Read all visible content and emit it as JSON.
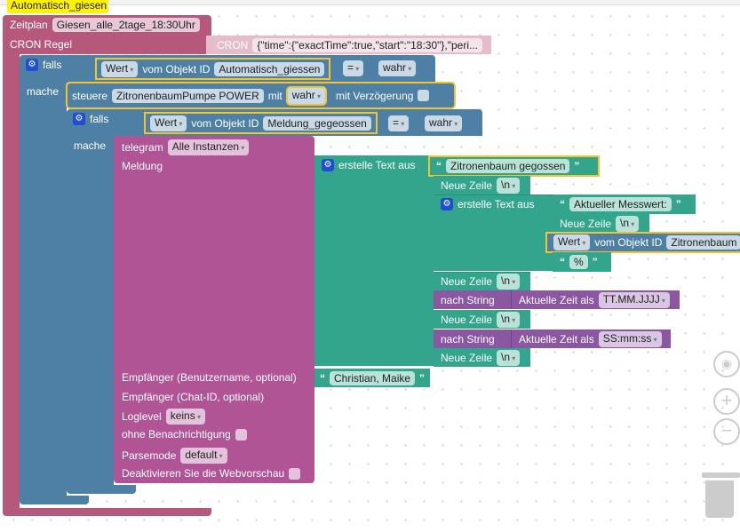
{
  "comment_tab": "Automatisch_giesen",
  "schedule": {
    "label": "Zeitplan",
    "name": "Giesen_alle_2tage_18:30Uhr",
    "cron_label": "CRON Regel",
    "cron_block_label": "CRON",
    "cron_value": "{\"time\":{\"exactTime\":true,\"start\":\"18:30\"},\"peri..."
  },
  "if1": {
    "falls": "falls",
    "mache": "mache",
    "value": "Wert",
    "from_obj": "vom Objekt ID",
    "obj": "Automatisch_giessen",
    "op": "=",
    "bool": "wahr"
  },
  "control": {
    "label": "steuere",
    "obj": "ZitronenbaumPumpe POWER",
    "with": "mit",
    "value": "wahr",
    "delay_label": "mit Verzögerung"
  },
  "if2": {
    "falls": "falls",
    "mache": "mache",
    "value": "Wert",
    "from_obj": "vom Objekt ID",
    "obj": "Meldung_gegeossen",
    "op": "=",
    "bool": "wahr"
  },
  "telegram": {
    "label": "telegram",
    "instance": "Alle Instanzen",
    "message": "Meldung",
    "recipient_user": "Empfänger (Benutzername, optional)",
    "recipient_chat": "Empfänger (Chat-ID, optional)",
    "loglevel_label": "Loglevel",
    "loglevel": "keins",
    "silent": "ohne Benachrichtigung",
    "parsemode_label": "Parsemode",
    "parsemode": "default",
    "disable_preview": "Deaktivieren Sie die Webvorschau",
    "user_value": "Christian, Maike"
  },
  "text1": {
    "label": "erstelle Text aus",
    "first": "Zitronenbaum gegossen",
    "newline": "Neue Zeile",
    "nl": "\\n",
    "to_string": "nach String",
    "time_label": "Aktuelle Zeit als",
    "date_fmt": "TT.MM.JJJJ",
    "time_fmt": "SS:mm:ss"
  },
  "text2": {
    "label": "erstelle Text aus",
    "first": "Aktueller Messwert:",
    "newline": "Neue Zeile",
    "nl": "\\n",
    "value": "Wert",
    "from_obj": "vom Objekt ID",
    "obj": "Zitronenbaum",
    "pct": "%"
  },
  "quote_open": "“",
  "quote_close": "”",
  "controls": {
    "center": "target-icon",
    "zoom_in": "+",
    "zoom_out": "−"
  }
}
